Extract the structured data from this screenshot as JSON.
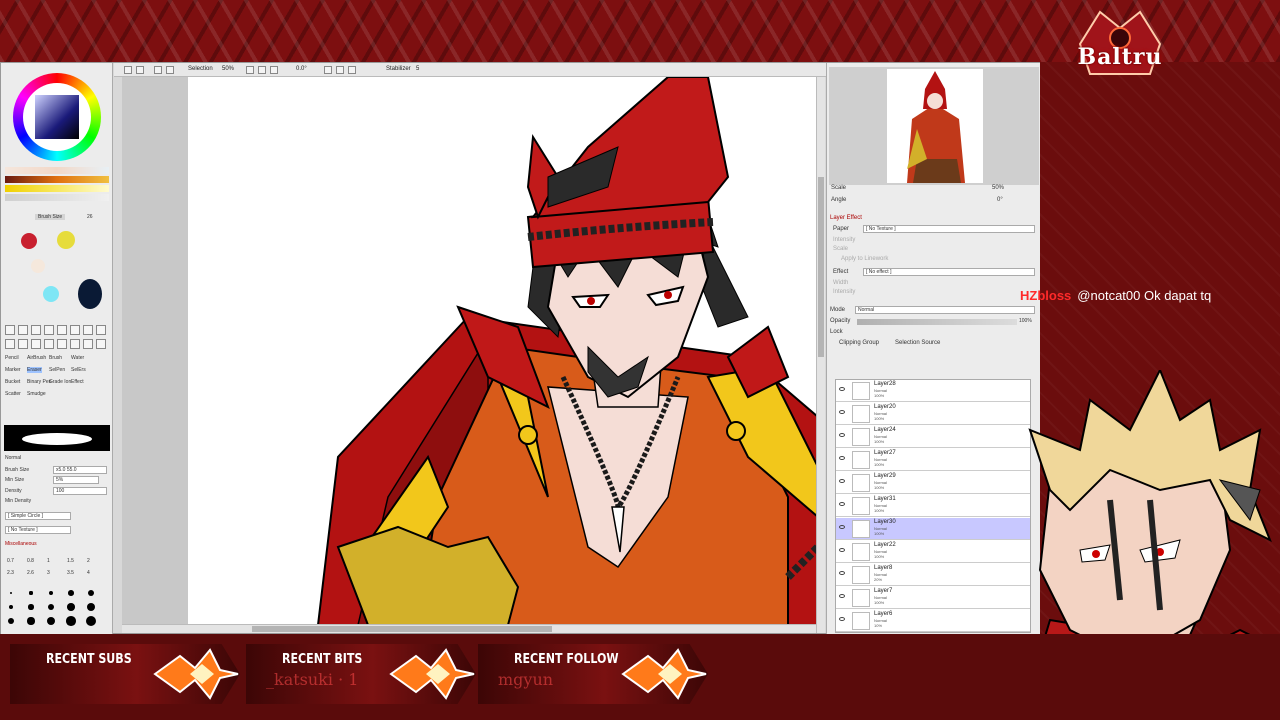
{
  "app": {
    "toolbar": {
      "selection_label": "Selection",
      "zoom": "50%",
      "rotation": "0.0°",
      "stabilizer_label": "Stabilizer",
      "stabilizer_value": "5"
    },
    "left_panel": {
      "brush_size_label": "Brush Size",
      "brush_size_value": "26",
      "brush_size_field_label": "Brush Size",
      "brush_size_field_value": "x5.0",
      "brush_size_field_right": "55.0",
      "min_size_label": "Min Size",
      "min_size_value": "5%",
      "density_label": "Density",
      "density_value": "100",
      "min_density_label": "Min Density",
      "shape_label": "[ Simple Circle ]",
      "texture_label": "[ No Texture ]",
      "misc_label": "Miscellaneous",
      "blend_label": "Normal",
      "tools": [
        "Pencil",
        "AirBrush",
        "Brush",
        "Water",
        "Marker",
        "Eraser",
        "SelPen",
        "SelErs",
        "Bucket",
        "Binary Pen",
        "Grade Ion",
        "Effect",
        "Scatter",
        "Smudge"
      ],
      "dot_sizes": [
        "0.7",
        "0.8",
        "1",
        "1.5",
        "2",
        "2.3",
        "2.6",
        "3",
        "3.5",
        "4"
      ],
      "swatch_colors": [
        "#c8202f",
        "#e6dc3c",
        "#f5e8dc",
        "#7ee6f5",
        "#0a1a35"
      ]
    },
    "right_panel": {
      "scale_label": "Scale",
      "scale_value": "50%",
      "angle_label": "Angle",
      "angle_value": "0°",
      "layer_effect_label": "Layer Effect",
      "paper_label": "Paper",
      "paper_value": "[ No Texture ]",
      "intensity_label": "Intensity",
      "scale2_label": "Scale",
      "apply_label": "Apply to Linework",
      "effect_label": "Effect",
      "effect_value": "[ No effect ]",
      "width_label": "Width",
      "intensity2_label": "Intensity",
      "mode_label": "Mode",
      "mode_value": "Normal",
      "opacity_label": "Opacity",
      "opacity_value": "100%",
      "lock_label": "Lock",
      "clipping_label": "Clipping Group",
      "selection_source_label": "Selection Source",
      "layers": [
        {
          "name": "Layer28",
          "mode": "Normal",
          "opacity": "100%",
          "selected": false
        },
        {
          "name": "Layer20",
          "mode": "Normal",
          "opacity": "100%",
          "selected": false
        },
        {
          "name": "Layer24",
          "mode": "Normal",
          "opacity": "100%",
          "selected": false
        },
        {
          "name": "Layer27",
          "mode": "Normal",
          "opacity": "100%",
          "selected": false
        },
        {
          "name": "Layer29",
          "mode": "Normal",
          "opacity": "100%",
          "selected": false
        },
        {
          "name": "Layer31",
          "mode": "Normal",
          "opacity": "100%",
          "selected": false
        },
        {
          "name": "Layer30",
          "mode": "Normal",
          "opacity": "100%",
          "selected": true
        },
        {
          "name": "Layer22",
          "mode": "Normal",
          "opacity": "100%",
          "selected": false
        },
        {
          "name": "Layer8",
          "mode": "Normal",
          "opacity": "20%",
          "selected": false
        },
        {
          "name": "Layer7",
          "mode": "Normal",
          "opacity": "100%",
          "selected": false
        },
        {
          "name": "Layer6",
          "mode": "Normal",
          "opacity": "10%",
          "selected": false
        }
      ]
    }
  },
  "stream": {
    "logo_text": "Baltru",
    "chat": {
      "user": "HZbloss",
      "message": "@notcat00 Ok dapat tq"
    },
    "tickers": [
      {
        "title": "RECENT SUBS",
        "value": ""
      },
      {
        "title": "RECENT BITS",
        "value": "_katsuki · 1"
      },
      {
        "title": "RECENT FOLLOW",
        "value": "mgyun"
      }
    ]
  }
}
